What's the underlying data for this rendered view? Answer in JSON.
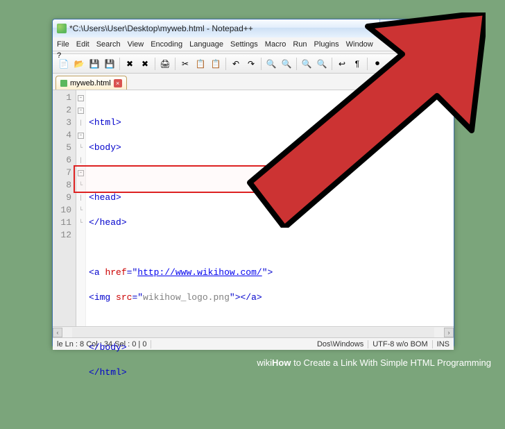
{
  "window": {
    "title": "*C:\\Users\\User\\Desktop\\myweb.html - Notepad++"
  },
  "menu": {
    "file": "File",
    "edit": "Edit",
    "search": "Search",
    "view": "View",
    "encoding": "Encoding",
    "language": "Language",
    "settings": "Settings",
    "macro": "Macro",
    "run": "Run",
    "plugins": "Plugins",
    "window": "Window",
    "help": "?",
    "closedoc": "x"
  },
  "tab": {
    "label": "myweb.html"
  },
  "code": {
    "lines": [
      "1",
      "2",
      "3",
      "4",
      "5",
      "6",
      "7",
      "8",
      "9",
      "10",
      "11",
      "12"
    ],
    "l1_open": "<",
    "l1_tag": "html",
    "l1_close": ">",
    "l2_open": "<",
    "l2_tag": "body",
    "l2_close": ">",
    "l4_open": "<",
    "l4_tag": "head",
    "l4_close": ">",
    "l5_open": "</",
    "l5_tag": "head",
    "l5_close": ">",
    "l7a": "<",
    "l7tag": "a",
    "l7sp": " ",
    "l7attr": "href",
    "l7eq": "=\"",
    "l7url": "http://www.wikihow.com/",
    "l7q": "\"",
    "l7end": ">",
    "l8a": "<",
    "l8tag": "img",
    "l8sp": " ",
    "l8attr": "src",
    "l8eq": "=\"",
    "l8val": "wikihow_logo.png",
    "l8q": "\"",
    "l8c": "></",
    "l8ctag": "a",
    "l8end": ">",
    "l10_open": "</",
    "l10_tag": "body",
    "l10_close": ">",
    "l11_open": "</",
    "l11_tag": "html",
    "l11_close": ">"
  },
  "status": {
    "pos": "le Ln : 8    Col : 34    Sel : 0 | 0",
    "eol": "Dos\\Windows",
    "enc": "UTF-8 w/o BOM",
    "mode": "INS"
  },
  "watermark": {
    "brand1": "wiki",
    "brand2": "How",
    "rest": " to Create a Link With Simple HTML Programming"
  }
}
